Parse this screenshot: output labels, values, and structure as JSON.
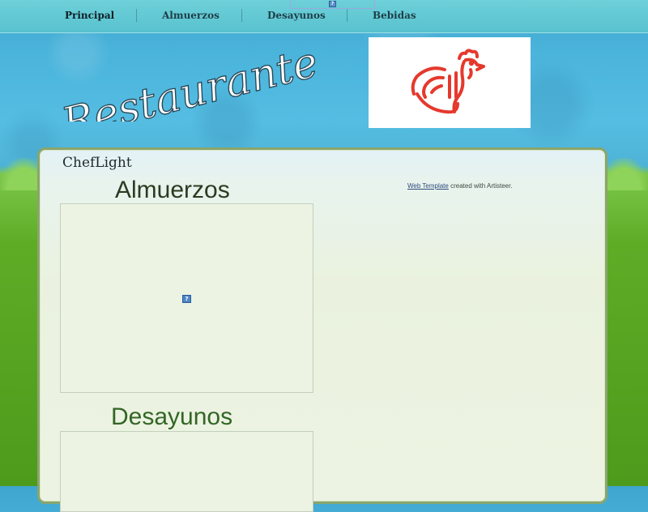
{
  "nav": {
    "items": [
      {
        "label": "Principal",
        "active": true
      },
      {
        "label": "Almuerzos",
        "active": false
      },
      {
        "label": "Desayunos",
        "active": false
      },
      {
        "label": "Bebidas",
        "active": false
      }
    ],
    "top_image_icon": "broken-image-icon"
  },
  "header": {
    "logo_text": "Restaurante",
    "logo_image_icon": "rooster-hand-icon"
  },
  "panel": {
    "site_name": "ChefLight",
    "sections": [
      {
        "title": "Almuerzos",
        "media_icon": "broken-image-icon"
      },
      {
        "title": "Desayunos"
      }
    ],
    "credit": {
      "link_text": "Web Template",
      "suffix": "created with Artisteer."
    }
  },
  "colors": {
    "sky": "#4ab3da",
    "grass": "#5eac26",
    "logo_red": "#e5392d",
    "section_green": "#336625"
  }
}
